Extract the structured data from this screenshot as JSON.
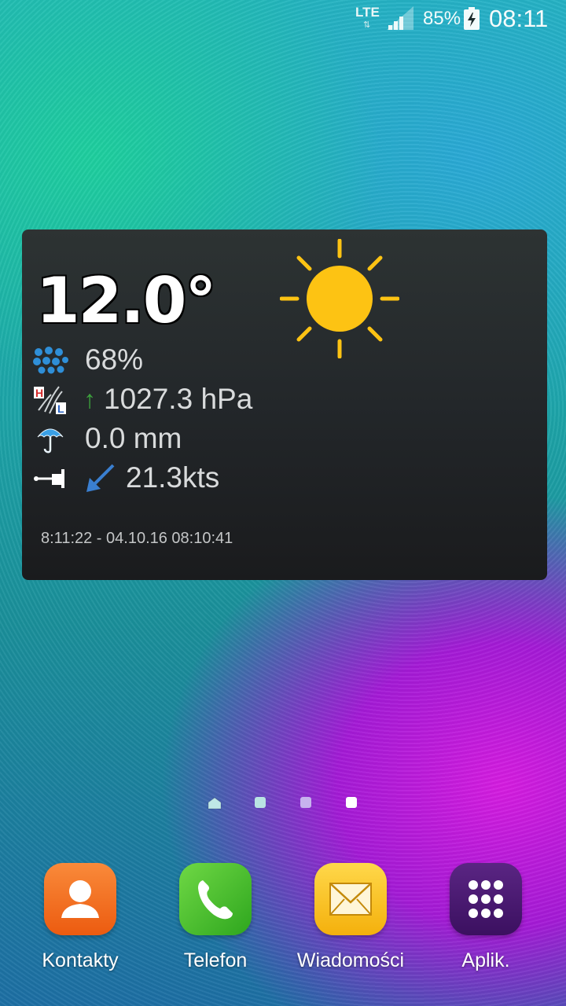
{
  "status_bar": {
    "network": "LTE",
    "network_arrows": "⇅",
    "battery_percent": "85%",
    "battery_level": 0.85,
    "time": "08:11",
    "icons": [
      "signal-bars-icon",
      "battery-charging-icon"
    ]
  },
  "widget": {
    "temperature": "12.0°",
    "condition_icon": "sun-icon",
    "humidity": "68%",
    "pressure": "1027.3 hPa",
    "pressure_trend": "↑",
    "rain": "0.0 mm",
    "wind": "21.3kts",
    "wind_direction_icon": "arrow-down-left-icon",
    "timestamp": "8:11:22 - 04.10.16 08:10:41",
    "colors": {
      "sun": "#fdc313",
      "humidity": "#2f8fd8",
      "trend": "#3da33d",
      "wind_arrow": "#3a7fd0"
    }
  },
  "pager": {
    "pages": 4,
    "current": 4
  },
  "dock": {
    "items": [
      {
        "label": "Kontakty",
        "icon": "contacts-icon",
        "color": "#f26b1d"
      },
      {
        "label": "Telefon",
        "icon": "phone-icon",
        "color": "#3cb82a"
      },
      {
        "label": "Wiadomości",
        "icon": "messages-icon",
        "color": "#f9c114"
      },
      {
        "label": "Aplik.",
        "icon": "apps-grid-icon",
        "color": "#4a1a6e"
      }
    ]
  }
}
